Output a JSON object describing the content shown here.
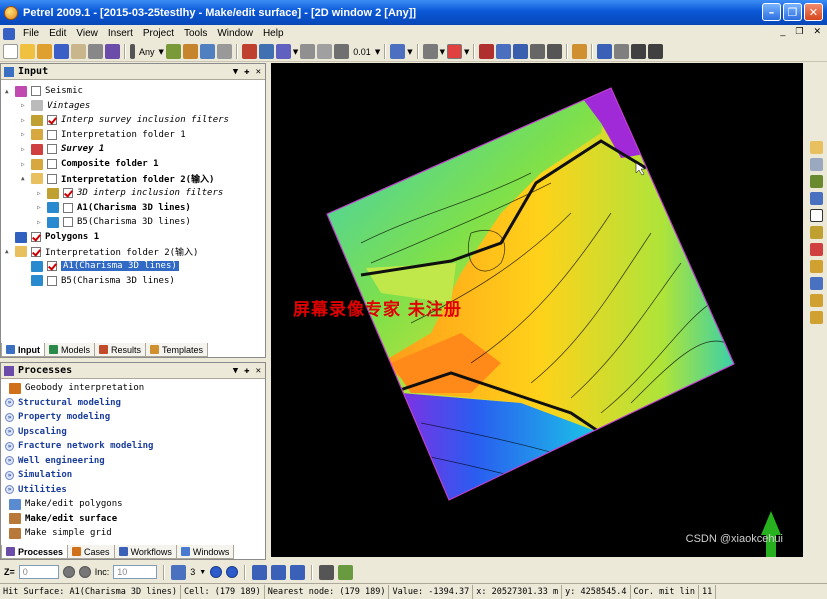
{
  "window": {
    "title": "Petrel 2009.1 - [2015-03-25testlhy - Make/edit surface] - [2D window 2 [Any]]"
  },
  "menu": [
    "File",
    "Edit",
    "View",
    "Insert",
    "Project",
    "Tools",
    "Window",
    "Help"
  ],
  "toolbar": {
    "filter_value": "Any",
    "zoom_value": "0.01"
  },
  "input_panel": {
    "title": "Input",
    "rows": [
      {
        "label": "Seismic",
        "checked": false,
        "expand": "▲"
      },
      {
        "label": "Vintages",
        "checked": null,
        "expand": "▷"
      },
      {
        "label": "Interp survey inclusion filters",
        "checked": true,
        "expand": "▷"
      },
      {
        "label": "Interpretation folder 1",
        "checked": false,
        "expand": "▷"
      },
      {
        "label": "Survey 1",
        "checked": false,
        "expand": "▷"
      },
      {
        "label": "Composite folder 1",
        "checked": false,
        "expand": "▷"
      },
      {
        "label": "Interpretation folder 2(输入)",
        "checked": false,
        "expand": "▲"
      },
      {
        "label": "3D interp inclusion filters",
        "checked": true,
        "expand": "▷"
      },
      {
        "label": "A1(Charisma 3D lines)",
        "checked": false,
        "expand": "▷"
      },
      {
        "label": "B5(Charisma 3D lines)",
        "checked": false,
        "expand": "▷"
      },
      {
        "label": "Polygons 1",
        "checked": true,
        "expand": ""
      },
      {
        "label": "Interpretation folder 2(输入)",
        "checked": true,
        "expand": "▲"
      },
      {
        "label": "A1(Charisma 3D lines)",
        "checked": true,
        "expand": ""
      },
      {
        "label": "B5(Charisma 3D lines)",
        "checked": false,
        "expand": ""
      }
    ],
    "tabs": [
      "Input",
      "Models",
      "Results",
      "Templates"
    ]
  },
  "processes_panel": {
    "title": "Processes",
    "rows": [
      {
        "label": "Geobody interpretation",
        "cat": false
      },
      {
        "label": "Structural modeling",
        "cat": true
      },
      {
        "label": "Property modeling",
        "cat": true
      },
      {
        "label": "Upscaling",
        "cat": true
      },
      {
        "label": "Fracture network modeling",
        "cat": true
      },
      {
        "label": "Well engineering",
        "cat": true
      },
      {
        "label": "Simulation",
        "cat": true
      },
      {
        "label": "Utilities",
        "cat": true
      },
      {
        "label": "Make/edit polygons",
        "cat": false
      },
      {
        "label": "Make/edit surface",
        "cat": false
      },
      {
        "label": "Make simple grid",
        "cat": false
      }
    ],
    "tabs": [
      "Processes",
      "Cases",
      "Workflows",
      "Windows"
    ]
  },
  "viewport": {
    "watermark": "屏幕录像专家 未注册",
    "csdn": "CSDN @xiaokcehui"
  },
  "bottom_toolbar": {
    "z_label": "Z=",
    "z_value": "0",
    "inc_label": "Inc:",
    "inc_value": "10",
    "step_value": "3"
  },
  "status": [
    "Hit Surface: A1(Charisma 3D lines)",
    "Cell: (179 189)",
    "Nearest node: (179 189)",
    "Value: -1394.37",
    "x: 20527301.33 m",
    "y: 4258545.4",
    "Cor. mit lin",
    "11"
  ]
}
